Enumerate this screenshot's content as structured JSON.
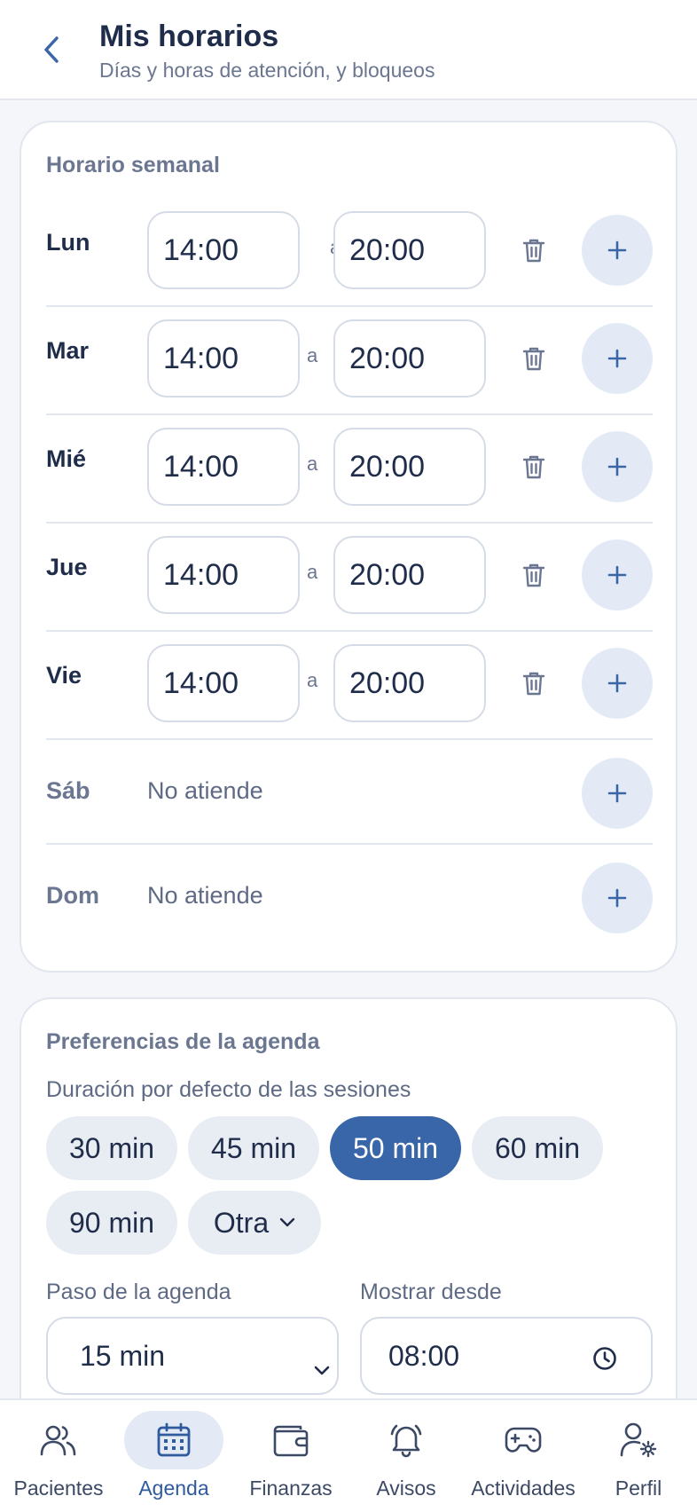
{
  "header": {
    "title": "Mis horarios",
    "subtitle": "Días y horas de atención, y bloqueos"
  },
  "weekly": {
    "title": "Horario semanal",
    "separator": "a",
    "days": [
      {
        "label": "Lun",
        "start": "14:00",
        "end": "20:00"
      },
      {
        "label": "Mar",
        "start": "14:00",
        "end": "20:00"
      },
      {
        "label": "Mié",
        "start": "14:00",
        "end": "20:00"
      },
      {
        "label": "Jue",
        "start": "14:00",
        "end": "20:00"
      },
      {
        "label": "Vie",
        "start": "14:00",
        "end": "20:00"
      },
      {
        "label": "Sáb",
        "status": "No atiende"
      },
      {
        "label": "Dom",
        "status": "No atiende"
      }
    ]
  },
  "preferences": {
    "title": "Preferencias de la agenda",
    "duration_label": "Duración por defecto de las sesiones",
    "durations": [
      "30 min",
      "45 min",
      "50 min",
      "60 min",
      "90 min",
      "Otra"
    ],
    "selected_duration": "50 min",
    "step_label": "Paso de la agenda",
    "step_value": "15 min",
    "show_from_label": "Mostrar desde",
    "show_from_value": "08:00"
  },
  "nav": {
    "items": [
      {
        "label": "Pacientes",
        "icon": "users-icon"
      },
      {
        "label": "Agenda",
        "icon": "calendar-icon",
        "active": true
      },
      {
        "label": "Finanzas",
        "icon": "wallet-icon"
      },
      {
        "label": "Avisos",
        "icon": "bell-icon"
      },
      {
        "label": "Actividades",
        "icon": "gamepad-icon"
      },
      {
        "label": "Perfil",
        "icon": "user-settings-icon"
      }
    ]
  },
  "colors": {
    "primary": "#3966a8",
    "text": "#1f2d4a",
    "muted": "#6b7690",
    "chip_bg": "#e8ecf3",
    "plus_bg": "#e3eaf6"
  }
}
